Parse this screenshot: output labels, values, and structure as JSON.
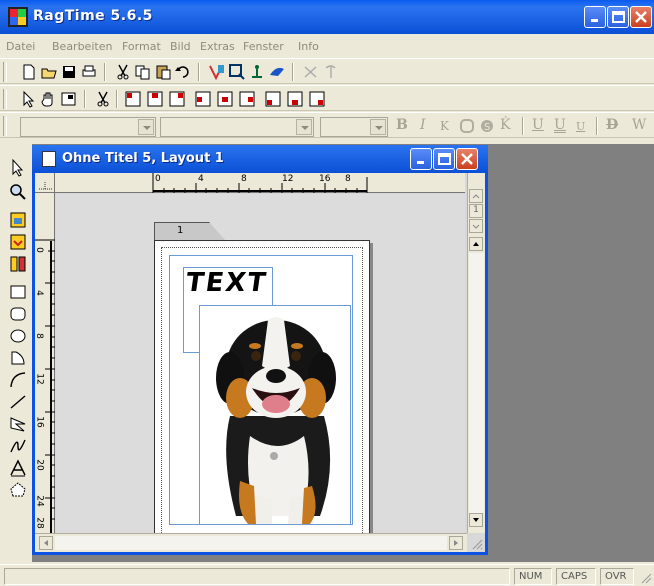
{
  "app": {
    "title": "RagTime 5.6.5"
  },
  "menu": [
    "Datei",
    "Bearbeiten",
    "Format",
    "Bild",
    "Extras",
    "Fenster",
    "Info"
  ],
  "document": {
    "title": "Ohne Titel 5, Layout 1",
    "page_tab": "1",
    "text_frame": "TEXT",
    "ruler_h": [
      "0",
      "4",
      "8",
      "12",
      "16",
      "8"
    ],
    "ruler_v": [
      "0",
      "4",
      "8",
      "12",
      "16",
      "20",
      "24",
      "28"
    ],
    "vscroll_page": "1"
  },
  "status": {
    "num": "NUM",
    "caps": "CAPS",
    "ovr": "OVR"
  },
  "colors": {
    "titlebar": "#0a5bf0",
    "frame": "#6b9ad6",
    "workspace": "#808080"
  }
}
